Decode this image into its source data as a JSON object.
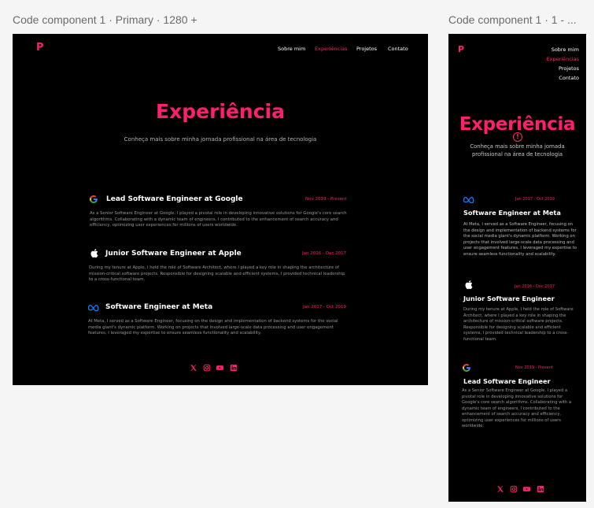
{
  "frames": {
    "desktop_label": "Code component 1 · Primary · 1280 +",
    "mobile_label": "Code component 1 · 1 - ..."
  },
  "site": {
    "logo": "P",
    "nav": [
      "Sobre mim",
      "Experiências",
      "Projetos",
      "Contato"
    ],
    "hero_title": "Experiência",
    "hero_subtitle": "Conheça mais sobre minha jornada profissional na área de tecnologia"
  },
  "desktop_jobs": [
    {
      "icon": "google-icon",
      "title": "Lead Software Engineer at Google",
      "date": "Nov 2019 - Present",
      "description": "As a Senior Software Engineer at Google, I played a pivotal role in developing innovative solutions for Google's core search algorithms. Collaborating with a dynamic team of engineers, I contributed to the enhancement of search accuracy and efficiency, optimizing user experiences for millions of users worldwide."
    },
    {
      "icon": "apple-icon",
      "title": "Junior Software Engineer at Apple",
      "date": "Jan 2016 - Dec 2017",
      "description": "During my tenure at Apple, I held the role of Software Architect, where I played a key role in shaping the architecture of mission-critical software projects. Responsible for designing scalable and efficient systems, I provided technical leadership to a cross-functional team."
    },
    {
      "icon": "meta-icon",
      "title": "Software Engineer at Meta",
      "date": "Jan 2017 - Oct 2019",
      "description": "At Meta, I served as a Software Engineer, focusing on the design and implementation of backend systems for the social media giant's dynamic platform. Working on projects that involved large-scale data processing and user engagement features, I leveraged my expertise to ensure seamless functionality and scalability."
    }
  ],
  "mobile_jobs": [
    {
      "icon": "meta-icon",
      "title": "Software Engineer at Meta",
      "date": "Jan 2017 - Oct 2019",
      "description": "At Meta, I served as a Software Engineer, focusing on the design and implementation of backend systems for the social media giant's dynamic platform. Working on projects that involved large-scale data processing and user engagement features, I leveraged my expertise to ensure seamless functionality and scalability."
    },
    {
      "icon": "apple-icon",
      "title": "Junior Software Engineer",
      "date": "Jan 2016 - Dec 2017",
      "description": "During my tenure at Apple, I held the role of Software Architect, where I played a key role in shaping the architecture of mission-critical software projects. Responsible for designing scalable and efficient systems, I provided technical leadership to a cross-functional team."
    },
    {
      "icon": "google-icon",
      "title": "Lead Software Engineer",
      "date": "Nov 2019 - Present",
      "description": "As a Senior Software Engineer at Google, I played a pivotal role in developing innovative solutions for Google's core search algorithms. Collaborating with a dynamic team of engineers, I contributed to the enhancement of search accuracy and efficiency, optimizing user experiences for millions of users worldwide."
    }
  ],
  "socials": [
    "x-icon",
    "instagram-icon",
    "youtube-icon",
    "linkedin-icon"
  ],
  "colors": {
    "accent": "#ff1f6f",
    "background": "#000000",
    "canvas": "#f5f5f5",
    "warning": "#ff2e5a"
  }
}
